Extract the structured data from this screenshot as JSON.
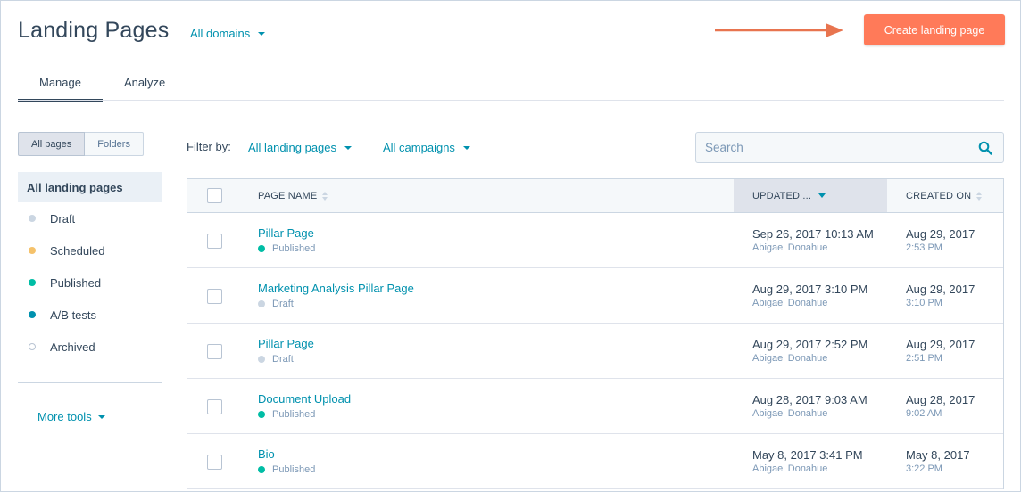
{
  "header": {
    "title": "Landing Pages",
    "domains_label": "All domains",
    "create_label": "Create landing page"
  },
  "tabs": [
    {
      "label": "Manage",
      "active": true
    },
    {
      "label": "Analyze",
      "active": false
    }
  ],
  "sidebar": {
    "segments": [
      {
        "label": "All pages",
        "active": true
      },
      {
        "label": "Folders",
        "active": false
      }
    ],
    "items": [
      {
        "label": "All landing pages",
        "active": true
      },
      {
        "label": "Draft",
        "dot_color": "#cbd6e2"
      },
      {
        "label": "Scheduled",
        "dot_color": "#f5c26b"
      },
      {
        "label": "Published",
        "dot_color": "#00bda5"
      },
      {
        "label": "A/B tests",
        "dot_color": "#0091ae"
      },
      {
        "label": "Archived",
        "dot_color": "#ffffff"
      }
    ],
    "more_tools": "More tools"
  },
  "filters": {
    "label": "Filter by:",
    "pages": "All landing pages",
    "campaigns": "All campaigns",
    "search_placeholder": "Search"
  },
  "table": {
    "columns": {
      "name": "PAGE NAME",
      "updated": "UPDATED ...",
      "created": "CREATED ON"
    },
    "rows": [
      {
        "name": "Pillar Page",
        "status": "Published",
        "status_color": "#00bda5",
        "updated": "Sep 26, 2017 10:13 AM",
        "updated_by": "Abigael Donahue",
        "created": "Aug 29, 2017",
        "created_time": "2:53 PM"
      },
      {
        "name": "Marketing Analysis Pillar Page",
        "status": "Draft",
        "status_color": "#cbd6e2",
        "updated": "Aug 29, 2017 3:10 PM",
        "updated_by": "Abigael Donahue",
        "created": "Aug 29, 2017",
        "created_time": "3:10 PM"
      },
      {
        "name": "Pillar Page",
        "status": "Draft",
        "status_color": "#cbd6e2",
        "updated": "Aug 29, 2017 2:52 PM",
        "updated_by": "Abigael Donahue",
        "created": "Aug 29, 2017",
        "created_time": "2:51 PM"
      },
      {
        "name": "Document Upload",
        "status": "Published",
        "status_color": "#00bda5",
        "updated": "Aug 28, 2017 9:03 AM",
        "updated_by": "Abigael Donahue",
        "created": "Aug 28, 2017",
        "created_time": "9:02 AM"
      },
      {
        "name": "Bio",
        "status": "Published",
        "status_color": "#00bda5",
        "updated": "May 8, 2017 3:41 PM",
        "updated_by": "Abigael Donahue",
        "created": "May 8, 2017",
        "created_time": "3:22 PM"
      }
    ]
  },
  "colors": {
    "accent": "#0091ae",
    "primary_button": "#ff7a59",
    "arrow": "#e8744f"
  },
  "icons": {
    "search": "search-icon",
    "arrow": "arrow-right-icon"
  }
}
